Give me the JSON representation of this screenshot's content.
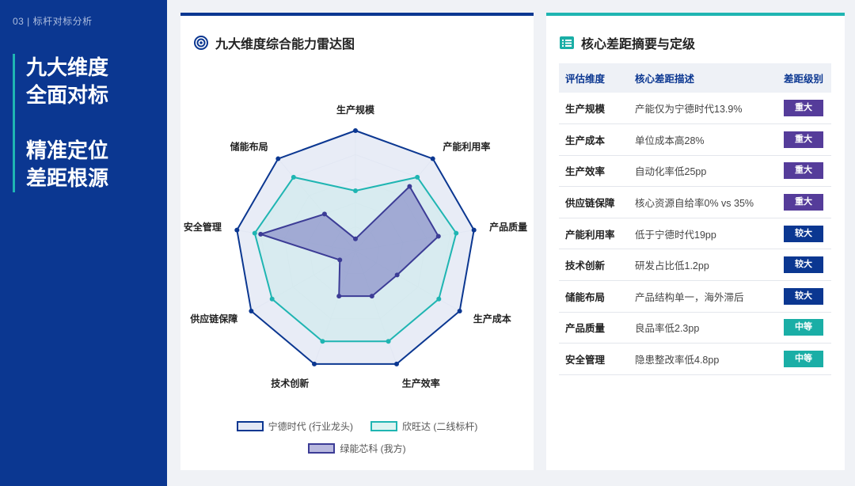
{
  "page": {
    "crumb": "03 | 标杆对标分析",
    "headline": [
      "九大维度",
      "全面对标",
      "精准定位",
      "差距根源"
    ]
  },
  "left_card": {
    "title": "九大维度综合能力雷达图",
    "icon": "target-icon"
  },
  "right_card": {
    "title": "核心差距摘要与定级",
    "icon": "list-icon",
    "table": {
      "headers": [
        "评估维度",
        "核心差距描述",
        "差距级别"
      ],
      "rows": [
        {
          "dimension": "生产规模",
          "desc": "产能仅为宁德时代13.9%",
          "level": "重大"
        },
        {
          "dimension": "生产成本",
          "desc": "单位成本高28%",
          "level": "重大"
        },
        {
          "dimension": "生产效率",
          "desc": "自动化率低25pp",
          "level": "重大"
        },
        {
          "dimension": "供应链保障",
          "desc": "核心资源自给率0% vs 35%",
          "level": "重大"
        },
        {
          "dimension": "产能利用率",
          "desc": "低于宁德时代19pp",
          "level": "较大"
        },
        {
          "dimension": "技术创新",
          "desc": "研发占比低1.2pp",
          "level": "较大"
        },
        {
          "dimension": "储能布局",
          "desc": "产品结构单一，海外滞后",
          "level": "较大"
        },
        {
          "dimension": "产品质量",
          "desc": "良品率低2.3pp",
          "level": "中等"
        },
        {
          "dimension": "安全管理",
          "desc": "隐患整改率低4.8pp",
          "level": "中等"
        }
      ]
    },
    "level_colors": {
      "重大": "#553c9a",
      "较大": "#0b3791",
      "中等": "#1aaea6"
    }
  },
  "chart_data": {
    "type": "radar",
    "categories": [
      "生产规模",
      "产能利用率",
      "产品质量",
      "生产成本",
      "生产效率",
      "技术创新",
      "供应链保障",
      "安全管理",
      "储能布局"
    ],
    "rmax": 100,
    "rings": 5,
    "series": [
      {
        "name": "宁德时代 (行业龙头)",
        "stroke": "#0b3791",
        "fill": "#e4e9f5",
        "fill_opacity": 0.85,
        "values": [
          100,
          100,
          100,
          100,
          100,
          100,
          100,
          100,
          100
        ]
      },
      {
        "name": "欣旺达 (二线标杆)",
        "stroke": "#1fb5b2",
        "fill": "#c6ebe8",
        "fill_opacity": 0.45,
        "values": [
          50,
          80,
          85,
          80,
          80,
          80,
          80,
          85,
          80
        ]
      },
      {
        "name": "绿能芯科 (我方)",
        "stroke": "#3c3c96",
        "fill": "#6a6ab8",
        "fill_opacity": 0.5,
        "values": [
          10,
          70,
          70,
          40,
          40,
          40,
          15,
          80,
          40
        ]
      }
    ]
  }
}
